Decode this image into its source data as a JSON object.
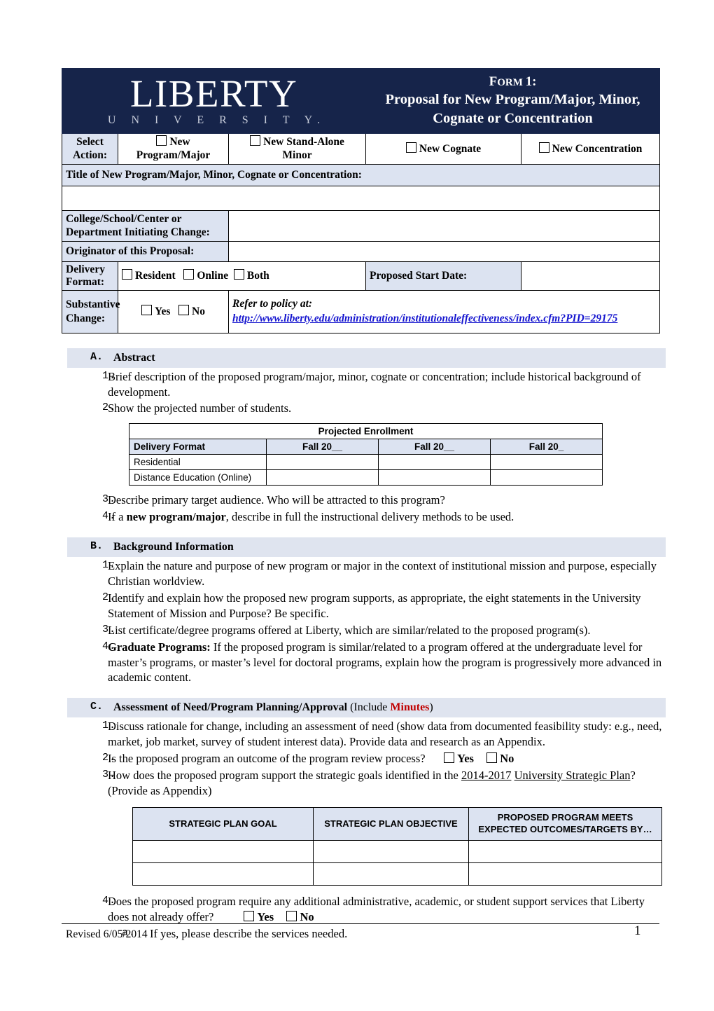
{
  "header": {
    "logo_main": "LIBERTY",
    "logo_sub": "U N I V E R S I T Y.",
    "form_label_big": "F",
    "form_label_rest": "ORM ",
    "form_number": "1:",
    "title_line2": "Proposal for New Program/Major, Minor,",
    "title_line3": "Cognate or Concentration",
    "navy": "#16244a",
    "label_bg": "#dce3f1"
  },
  "select_action": {
    "label_line1": "Select",
    "label_line2": "Action:",
    "options": [
      {
        "line1": "New",
        "line2": "Program/Major"
      },
      {
        "line1": "New Stand-Alone",
        "line2": "Minor"
      },
      {
        "line1": "New Cognate",
        "line2": ""
      },
      {
        "line1": "New Concentration",
        "line2": ""
      }
    ]
  },
  "fields": {
    "title_label": "Title of New Program/Major, Minor, Cognate or Concentration:",
    "title_value": "",
    "college_label_line1": "College/School/Center or",
    "college_label_line2": "Department Initiating Change:",
    "college_value": "",
    "originator_label": "Originator of this Proposal:",
    "originator_value": "",
    "delivery_label": "Delivery Format:",
    "delivery_options": [
      "Resident",
      "Online",
      "Both"
    ],
    "start_date_label": "Proposed Start Date:",
    "start_date_value": "",
    "substantive_label_line1": "Substantive",
    "substantive_label_line2": "Change:",
    "substantive_options": [
      "Yes",
      "No"
    ],
    "policy_label": "Refer to policy at:",
    "policy_url_line1": "http://www.liberty.edu/administration/institutionaleffectiveness/index.cfm?",
    "policy_url_line2": "PID=29175",
    "policy_link_color": "#1515cf"
  },
  "sections": [
    {
      "letter": "A.",
      "heading": "Abstract",
      "heading_suffix": "",
      "items": [
        {
          "num": "1.",
          "text": "Brief description of the proposed program/major, minor, cognate or concentration; include historical background of development."
        },
        {
          "num": "2.",
          "text": "Show the projected number of students."
        },
        {
          "num": "3.",
          "text": "Describe primary target audience. Who will be attracted to this program?"
        },
        {
          "num": "4.",
          "text": "If a new program/major, describe in full the instructional delivery methods to be used.",
          "bold_part": "new program/major"
        }
      ]
    },
    {
      "letter": "B.",
      "heading": "Background Information",
      "items": [
        {
          "num": "1.",
          "text": "Explain the nature and purpose of new program or major in the context of institutional mission and purpose, especially Christian worldview."
        },
        {
          "num": "2.",
          "text": "Identify and explain how the proposed new program supports, as appropriate, the eight statements in the University Statement of Mission and Purpose? Be specific."
        },
        {
          "num": "3.",
          "text": "List certificate/degree programs offered at Liberty, which are similar/related to the proposed program(s)."
        },
        {
          "num": "4.",
          "bold_lead": "Graduate Programs:",
          "text": " If the proposed program is similar/related to a program offered at the undergraduate level for master’s programs, or master’s level for doctoral programs, explain how the program is progressively more advanced in academic content."
        }
      ]
    },
    {
      "letter": "C.",
      "heading": "Assessment of Need/Program Planning/Approval",
      "heading_paren_open": " (Include ",
      "heading_red": "Minutes",
      "heading_paren_close": ")",
      "items": [
        {
          "num": "1.",
          "text": "Discuss rationale for change, including an assessment of need (show data from documented feasibility study: e.g., need, market, job market, survey of student interest data). Provide data and research as an Appendix."
        },
        {
          "num": "2.",
          "text": "Is the proposed program an outcome of the program review process?",
          "yes": "Yes",
          "no": "No"
        },
        {
          "num": "3.",
          "text_a": "How does the proposed program support the strategic goals identified in the ",
          "underline1": "2014-2017",
          "text_b": " ",
          "underline2": "University Strategic Plan",
          "text_c": "? (Provide as Appendix)"
        },
        {
          "num": "4.",
          "text": "Does the proposed program require any additional administrative, academic, or student support services that Liberty does not already offer?",
          "yes": "Yes",
          "no": "No",
          "sub": {
            "num": "a.",
            "text": "If yes, please describe the services needed."
          }
        }
      ]
    }
  ],
  "enrollment_table": {
    "title": "Projected Enrollment",
    "headers": [
      "Delivery Format",
      "Fall 20__",
      "Fall 20__",
      "Fall 20_"
    ],
    "rows": [
      {
        "label": "Residential",
        "cells": [
          "",
          "",
          ""
        ]
      },
      {
        "label": "Distance Education (Online)",
        "cells": [
          "",
          "",
          ""
        ]
      }
    ]
  },
  "strategic_plan_table": {
    "headers": [
      {
        "line1": "STRATEGIC PLAN GOAL",
        "line2": ""
      },
      {
        "line1": "STRATEGIC PLAN OBJECTIVE",
        "line2": ""
      },
      {
        "line1": "PROPOSED PROGRAM MEETS",
        "line2": "EXPECTED OUTCOMES/TARGETS BY…"
      }
    ],
    "rows": [
      [
        "",
        "",
        ""
      ],
      [
        "",
        "",
        ""
      ]
    ]
  },
  "footer": {
    "revised": "Revised 6/05/2014",
    "page_number": "1"
  }
}
